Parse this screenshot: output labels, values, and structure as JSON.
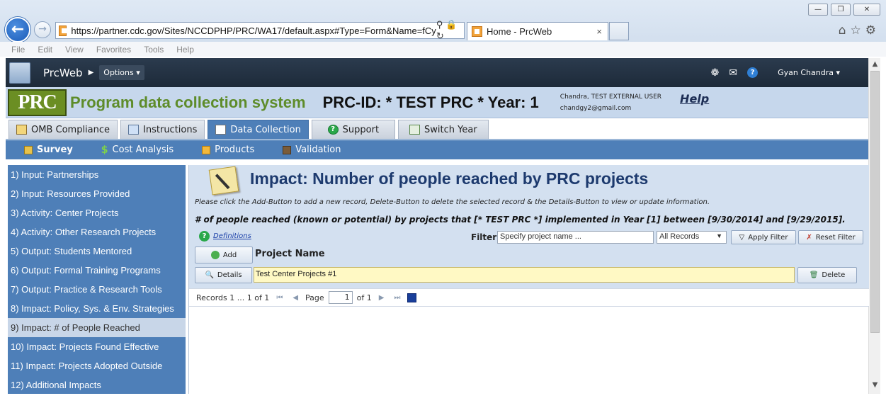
{
  "browser": {
    "url": "https://partner.cdc.gov/Sites/NCCDPHP/PRC/WA17/default.aspx#Type=Form&Name=fCy",
    "tab_title": "Home - PrcWeb",
    "tab_close": "×",
    "menu": [
      "File",
      "Edit",
      "View",
      "Favorites",
      "Tools",
      "Help"
    ]
  },
  "appbar": {
    "app_name": "PrcWeb",
    "options_label": "Options",
    "user_name": "Gyan Chandra"
  },
  "header": {
    "logo_text": "PRC",
    "system_title": "Program data collection system",
    "prc_id": "PRC-ID: * TEST PRC *  Year: 1",
    "user_line1": "Chandra, TEST EXTERNAL USER",
    "user_email": "chandgy2@gmail.com",
    "help_label": "Help"
  },
  "main_tabs": [
    {
      "label": "OMB Compliance"
    },
    {
      "label": "Instructions"
    },
    {
      "label": "Data Collection"
    },
    {
      "label": "Support"
    },
    {
      "label": "Switch Year"
    }
  ],
  "sub_tabs": [
    {
      "label": "Survey"
    },
    {
      "label": "Cost Analysis"
    },
    {
      "label": "Products"
    },
    {
      "label": "Validation"
    }
  ],
  "sidebar": {
    "items": [
      {
        "label": "1) Input: Partnerships"
      },
      {
        "label": "2) Input: Resources Provided"
      },
      {
        "label": "3) Activity: Center Projects"
      },
      {
        "label": "4) Activity: Other Research Projects"
      },
      {
        "label": "5) Output: Students Mentored"
      },
      {
        "label": "6) Output: Formal Training Programs"
      },
      {
        "label": "7) Output: Practice & Research Tools"
      },
      {
        "label": "8) Impact: Policy, Sys. & Env. Strategies"
      },
      {
        "label": "9) Impact: # of People Reached"
      },
      {
        "label": "10) Impact: Projects Found Effective"
      },
      {
        "label": "11) Impact: Projects Adopted Outside"
      },
      {
        "label": "12) Additional Impacts"
      }
    ]
  },
  "form": {
    "title": "Impact: Number of people reached by PRC projects",
    "instructions": "Please click the Add-Button to add a new record, Delete-Button to delete the selected record & the Details-Button to view or update information.",
    "reached_text": "# of people reached (known or potential) by projects that [* TEST PRC *] implemented in Year [1] between [9/30/2014] and [9/29/2015].",
    "definitions_label": "Definitions",
    "filter_label": "Filter",
    "filter_placeholder": "Specify project name ...",
    "filter_select_value": "All Records",
    "apply_filter_label": "Apply Filter",
    "reset_filter_label": "Reset Filter",
    "add_label": "Add",
    "column_header": "Project Name",
    "details_label": "Details",
    "record_value": "Test Center Projects #1",
    "delete_label": "Delete"
  },
  "pager": {
    "records_text": "Records 1 ... 1 of 1",
    "page_label": "Page",
    "page_value": "1",
    "of_text": "of 1"
  }
}
